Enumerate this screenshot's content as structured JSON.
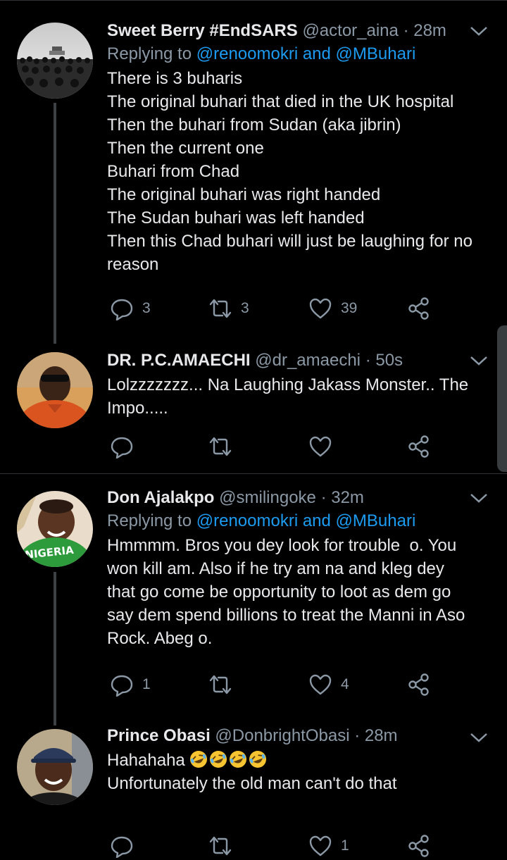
{
  "tweets": [
    {
      "name": "Sweet Berry #EndSARS",
      "handle": "@actor_aina",
      "time": "· 28m",
      "reply_prefix": "Replying to ",
      "reply_to": "@renoomokri and @MBuhari",
      "lines": [
        "There is 3 buharis",
        "The original buhari that died in the UK hospital",
        "Then the buhari from Sudan (aka jibrin)",
        "Then the current one",
        "Buhari from Chad",
        "The original buhari was right handed",
        "The Sudan buhari was left handed",
        "Then this Chad buhari will just be laughing for no",
        "reason"
      ],
      "replies": "3",
      "retweets": "3",
      "likes": "39"
    },
    {
      "name": "DR. P.C.AMAECHI",
      "handle": "@dr_amaechi",
      "time": "· 50s",
      "lines": [
        "Lolzzzzzzz... Na Laughing Jakass Monster.. The",
        "Impo....."
      ],
      "replies": "",
      "retweets": "",
      "likes": ""
    },
    {
      "name": "Don Ajalakpo",
      "handle": "@smilingoke",
      "time": "· 32m",
      "reply_prefix": "Replying to ",
      "reply_to": "@renoomokri and @MBuhari",
      "lines": [
        "Hmmmm. Bros you dey look for trouble  o. You",
        "won kill am. Also if he try am na and kleg dey",
        "that go come be opportunity to loot as dem go",
        "say dem spend billions to treat the Manni in Aso",
        "Rock. Abeg o."
      ],
      "replies": "1",
      "retweets": "",
      "likes": "4",
      "avatar_text": "NIGERIA"
    },
    {
      "name": "Prince Obasi",
      "handle": "@DonbrightObasi",
      "time": "· 28m",
      "lines": [
        "Hahahaha",
        "",
        "Unfortunately the old man can't do that"
      ],
      "emoji_count": 4,
      "replies": "",
      "retweets": "",
      "likes": "1"
    }
  ],
  "colors": {
    "background": "#000000",
    "text": "#e7e9ea",
    "muted": "#8b98a5",
    "link": "#1d9bf0",
    "divider": "#2f3336"
  },
  "icons": [
    "reply-icon",
    "retweet-icon",
    "like-icon",
    "share-icon",
    "chevron-down-icon",
    "laughing-emoji"
  ]
}
